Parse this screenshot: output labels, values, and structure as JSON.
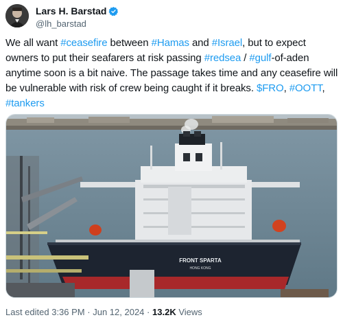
{
  "author": {
    "display_name": "Lars H. Barstad",
    "handle": "@lh_barstad",
    "verified_color": "#1d9bf0"
  },
  "tweet": {
    "segments": [
      {
        "text": "We all want ",
        "tag": false
      },
      {
        "text": "#ceasefire",
        "tag": true
      },
      {
        "text": " between ",
        "tag": false
      },
      {
        "text": "#Hamas",
        "tag": true
      },
      {
        "text": " and ",
        "tag": false
      },
      {
        "text": "#Israel",
        "tag": true
      },
      {
        "text": ", but to expect owners to put their seafarers at risk passing ",
        "tag": false
      },
      {
        "text": "#redsea",
        "tag": true
      },
      {
        "text": " / ",
        "tag": false
      },
      {
        "text": "#gulf",
        "tag": true
      },
      {
        "text": "-of-aden anytime soon is a bit naive. The passage takes time and any ceasefire will be vulnerable with risk of crew being caught if it breaks. ",
        "tag": false
      },
      {
        "text": "$FRO",
        "tag": true
      },
      {
        "text": ", ",
        "tag": false
      },
      {
        "text": "#OOTT",
        "tag": true
      },
      {
        "text": ", ",
        "tag": false
      },
      {
        "text": "#tankers",
        "tag": true
      }
    ]
  },
  "media": {
    "ship_name": "FRONT SPARTA",
    "ship_port": "HONG KONG"
  },
  "footer": {
    "edited_time": "Last edited 3:36 PM",
    "separator": "·",
    "date": "Jun 12, 2024",
    "views_count": "13.2K",
    "views_label": "Views"
  },
  "colors": {
    "link": "#1d9bf0",
    "secondary_text": "#536471",
    "hull_dark": "#1d2430",
    "hull_red": "#a8282a",
    "sea": "#6f8797"
  }
}
